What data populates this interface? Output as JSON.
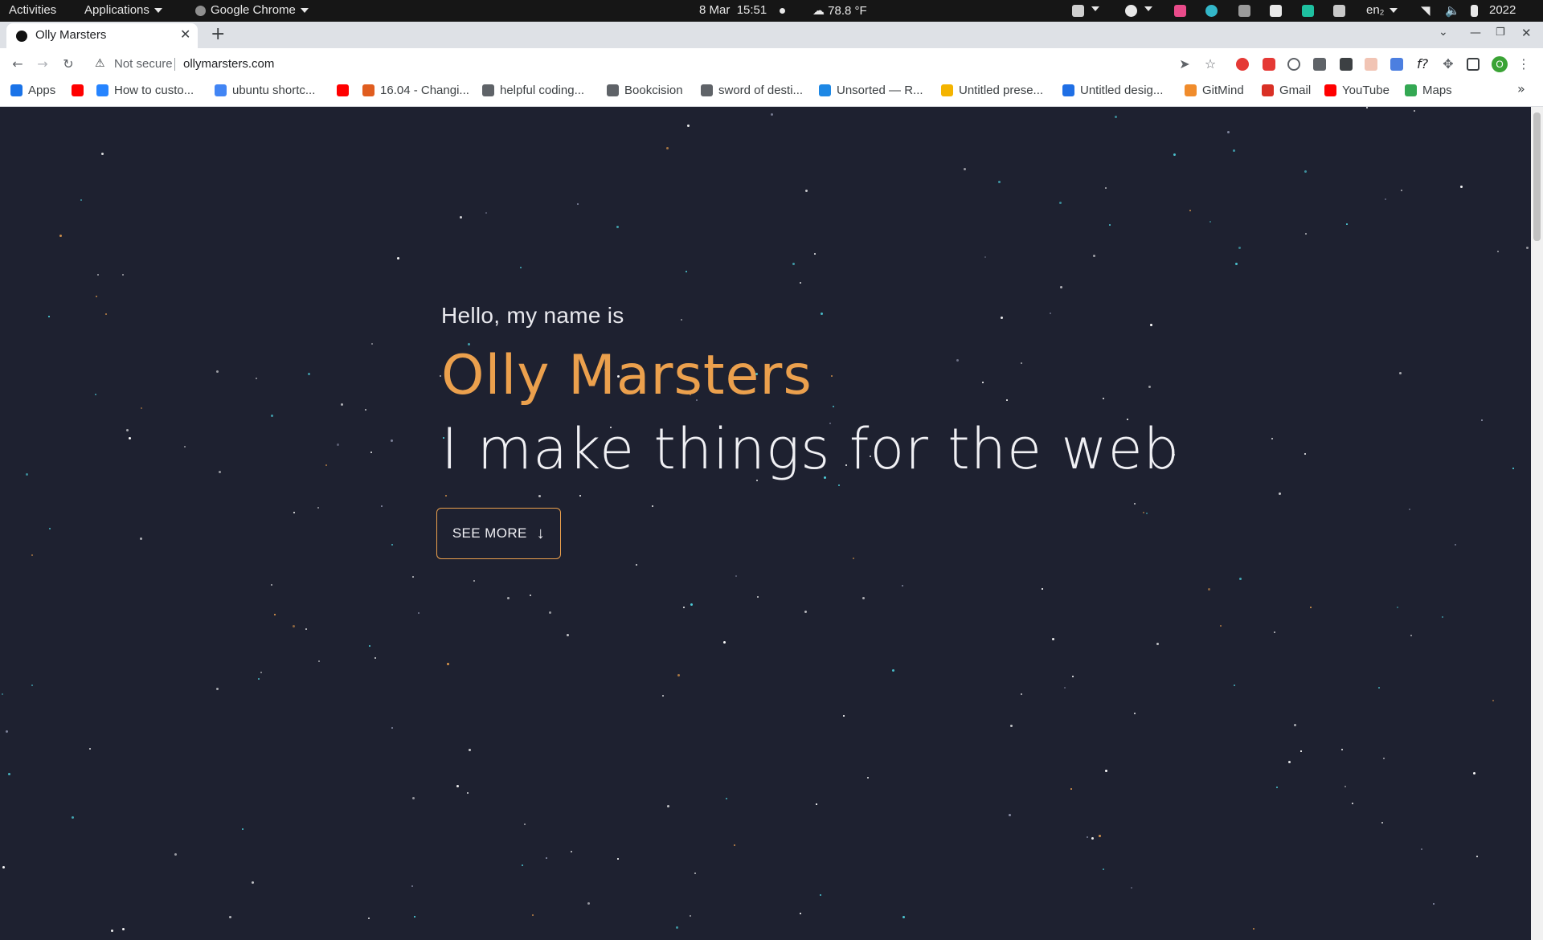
{
  "system_bar": {
    "activities": "Activities",
    "applications": "Applications",
    "app_name": "Google Chrome",
    "date": "8 Mar",
    "time": "15:51",
    "weather": "78.8 °F",
    "lang": "en₂",
    "year": "2022"
  },
  "browser": {
    "tab_title": "Olly Marsters",
    "security": "Not secure",
    "url": "ollymarsters.com",
    "bookmarks": [
      {
        "label": "Apps",
        "icon": "apps-grid-icon",
        "color": "#1a73e8"
      },
      {
        "label": "",
        "icon": "youtube-icon",
        "color": "#ff0000"
      },
      {
        "label": "How to custo...",
        "icon": "trello-icon",
        "color": "#2684ff"
      },
      {
        "label": "ubuntu shortc...",
        "icon": "google-icon",
        "color": "#4285f4"
      },
      {
        "label": "",
        "icon": "youtube-icon",
        "color": "#ff0000"
      },
      {
        "label": "16.04 - Changi...",
        "icon": "askubuntu-icon",
        "color": "#e05d1f"
      },
      {
        "label": "helpful coding...",
        "icon": "folder-icon",
        "color": "#5f6368"
      },
      {
        "label": "Bookcision",
        "icon": "globe-icon",
        "color": "#5f6368"
      },
      {
        "label": "sword of desti...",
        "icon": "y-icon",
        "color": "#5f6368"
      },
      {
        "label": "Unsorted — R...",
        "icon": "raindrop-icon",
        "color": "#1e88e5"
      },
      {
        "label": "Untitled prese...",
        "icon": "slides-icon",
        "color": "#f4b400"
      },
      {
        "label": "Untitled desig...",
        "icon": "canva-icon",
        "color": "#1f6fe5"
      },
      {
        "label": "GitMind",
        "icon": "gitmind-icon",
        "color": "#f08c2c"
      },
      {
        "label": "Gmail",
        "icon": "gmail-icon",
        "color": "#d93025"
      },
      {
        "label": "YouTube",
        "icon": "youtube-icon",
        "color": "#ff0000"
      },
      {
        "label": "Maps",
        "icon": "maps-icon",
        "color": "#34a853"
      }
    ],
    "more_bookmarks": "»"
  },
  "hero": {
    "greeting": "Hello, my name is",
    "name": "Olly Marsters",
    "tagline": "I make things for the web",
    "cta": "SEE MORE"
  },
  "colors": {
    "background": "#1e2130",
    "accent": "#eba04d",
    "text": "#f0f0f4"
  }
}
